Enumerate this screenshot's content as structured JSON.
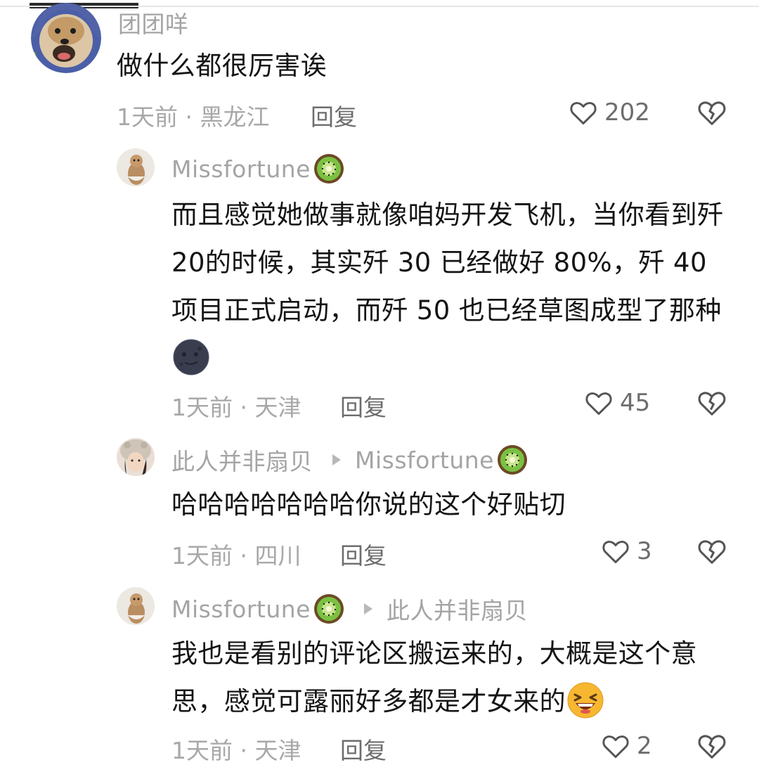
{
  "comments": [
    {
      "username": "团团咩",
      "text": "做什么都很厉害诶",
      "meta": "1天前 · 黑龙江",
      "reply": "回复",
      "likes": "202"
    },
    {
      "username": "Missfortune",
      "text": "而且感觉她做事就像咱妈开发飞机，当你看到歼 20的时候，其实歼 30 已经做好 80%，歼 40 项目正式启动，而歼 50 也已经草图成型了那种",
      "meta": "1天前 · 天津",
      "reply": "回复",
      "likes": "45"
    },
    {
      "username": "此人并非扇贝",
      "reply_to": "Missfortune",
      "text": "哈哈哈哈哈哈哈你说的这个好贴切",
      "meta": "1天前 · 四川",
      "reply": "回复",
      "likes": "3"
    },
    {
      "username": "Missfortune",
      "reply_to": "此人并非扇贝",
      "text": "我也是看别的评论区搬运来的，大概是这个意思，感觉可露丽好多都是才女来的",
      "meta": "1天前 · 天津",
      "reply": "回复",
      "likes": "2"
    }
  ],
  "icons": {
    "like": "heart-outline-icon",
    "dislike": "broken-heart-icon",
    "kiwi": "kiwi-emoji",
    "moon": "new-moon-face-emoji",
    "laugh": "grinning-squinting-face-emoji"
  },
  "colors": {
    "text": "#141414",
    "muted": "#a8a8a8",
    "reply": "#6d6d6d"
  }
}
